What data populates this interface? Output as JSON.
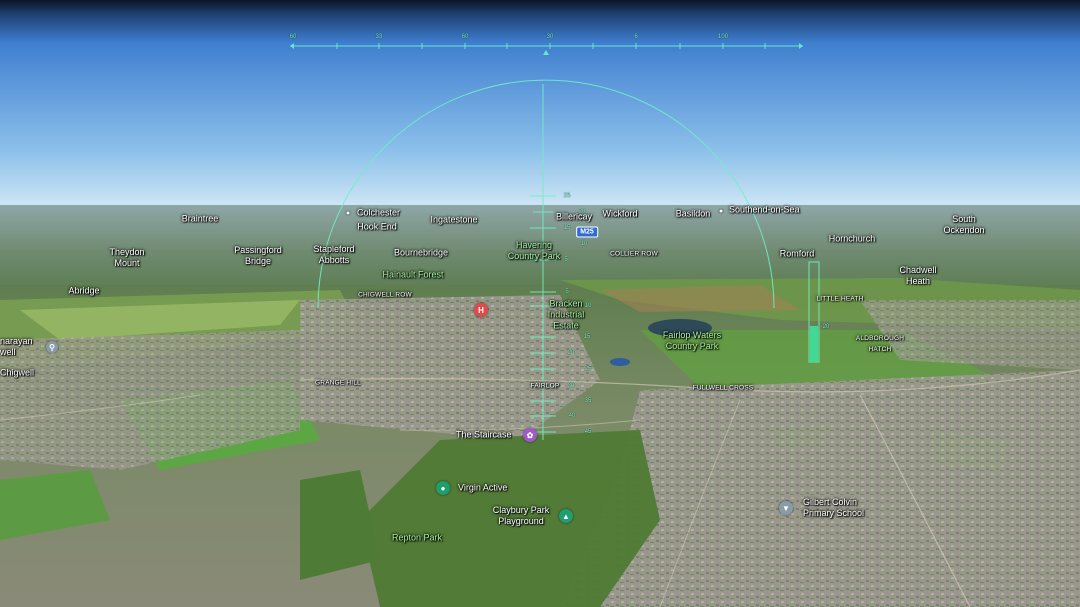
{
  "hud": {
    "heading_ticks": [
      "60",
      "33",
      "60",
      "30",
      "6",
      "100"
    ],
    "pitch_ticks": [
      "25",
      "20",
      "15",
      "10",
      "5",
      "5",
      "10",
      "15",
      "20",
      "25",
      "30",
      "35",
      "40",
      "45"
    ],
    "altitude_value": "20"
  },
  "places": {
    "braintree": "Braintree",
    "colchester": "Colchester",
    "ingatestone": "Ingatestone",
    "billericay": "Billericay",
    "wickford": "Wickford",
    "basildon": "Basildon",
    "southend": "Southend-on-Sea",
    "south_ockendon": "South\nOckendon",
    "hook_end": "Hook End",
    "theydon_mount": "Theydon\nMount",
    "passingford": "Passingford\nBridge",
    "stapleford": "Stapleford\nAbbotts",
    "bournebridge": "Bournebridge",
    "havering_park": "Havering\nCountry Park",
    "collier_row": "COLLIER ROW",
    "romford": "Romford",
    "hornchurch": "Hornchurch",
    "chadwell_heath": "Chadwell\nHeath",
    "abridge": "Abridge",
    "hainault": "Hainault Forest",
    "chigwell_row": "CHIGWELL ROW",
    "little_heath": "LITTLE HEATH",
    "brackenindustrial": "Bracken\nIndustrial\nEstate",
    "fairlop_waters": "Fairlop Waters\nCountry Park",
    "aldborough": "ALDBOROUGH\nHATCH",
    "narayan": "narayan\nwell",
    "chigwell": "Chigwell",
    "grange_hill": "GRANGE HILL",
    "fairlop": "FAIRLOP",
    "fullwell": "FULLWELL CROSS",
    "staircase": "The Staircase",
    "virgin_active": "Virgin Active",
    "clayburyplay": "Claybury Park\nPlayground",
    "gilbert_colvin": "Gilbert Colvin\nPrimary School",
    "repton_park": "Repton Park",
    "m25": "M25"
  },
  "colors": {
    "hud": "#6ff0c4",
    "sky_top": "#3f7fd0",
    "sky_horizon": "#d8ecf6",
    "hospital": "#e04a4a",
    "attraction": "#a259c8",
    "gym": "#1f9e6e",
    "school": "#8a9ba8"
  },
  "icons": {
    "hospital": "hospital-icon",
    "staircase": "attraction-icon",
    "virgin": "gym-icon",
    "playground": "playground-icon",
    "school": "school-icon",
    "station": "station-icon"
  }
}
